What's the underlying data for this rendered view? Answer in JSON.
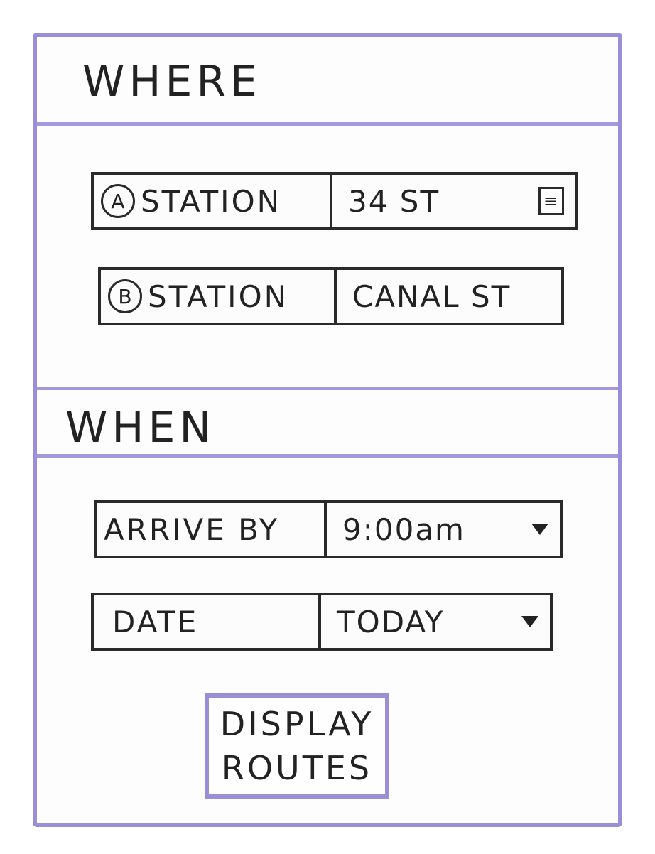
{
  "where": {
    "title": "WHERE",
    "fields": [
      {
        "badge": "A",
        "label": "STATION",
        "value": "34 ST",
        "icon": "list-icon"
      },
      {
        "badge": "B",
        "label": "STATION",
        "value": "CANAL ST"
      }
    ]
  },
  "when": {
    "title": "WHEN",
    "arrive": {
      "label": "ARRIVE BY",
      "value": "9:00am",
      "icon": "chevron-down-icon"
    },
    "date": {
      "label": "DATE",
      "value": "TODAY",
      "icon": "chevron-down-icon"
    }
  },
  "actions": {
    "display_line1": "DISPLAY",
    "display_line2": "ROUTES"
  },
  "colors": {
    "frame": "#9a8fd6",
    "ink": "#222222"
  }
}
